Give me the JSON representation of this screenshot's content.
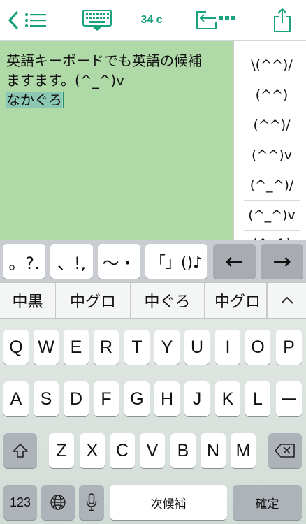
{
  "toolbar": {
    "char_count": "34 c",
    "icons": [
      "chevron-left-icon",
      "list-icon",
      "keyboard-hide-icon",
      "move-cursor-icon",
      "share-icon"
    ]
  },
  "colors": {
    "accent": "#18a27e",
    "editor_bg": "#b0d9a8",
    "marked_text_bg": "#8cc6b4"
  },
  "editor": {
    "line1": "英語キーボードでも英語の候補",
    "line2": "ますます。(^_^)v",
    "composing": "なかぐろ"
  },
  "side_candidates": [
    "\\(^^)/",
    "(^^)",
    "(^^)/",
    "(^^)v",
    "(^_^)/",
    "(^_^)v",
    "(^_^)"
  ],
  "symbol_row": {
    "keys": [
      "。?.",
      "、!,",
      "〜・",
      "「」()♪"
    ],
    "left_arrow": "←",
    "right_arrow": "→"
  },
  "conversion_candidates": [
    "中黒",
    "中グロ",
    "中ぐろ",
    "中グロ"
  ],
  "conversion_expand_icon": "chevron-up-icon",
  "keyboard": {
    "row1": [
      "Q",
      "W",
      "E",
      "R",
      "T",
      "Y",
      "U",
      "I",
      "O",
      "P"
    ],
    "row2": [
      "A",
      "S",
      "D",
      "F",
      "G",
      "H",
      "J",
      "K",
      "L",
      "ー"
    ],
    "row3": [
      "Z",
      "X",
      "C",
      "V",
      "B",
      "N",
      "M"
    ],
    "numbers_key": "123",
    "space_key": "次候補",
    "return_key": "確定",
    "icons": [
      "shift-icon",
      "delete-icon",
      "globe-icon",
      "microphone-icon"
    ]
  }
}
